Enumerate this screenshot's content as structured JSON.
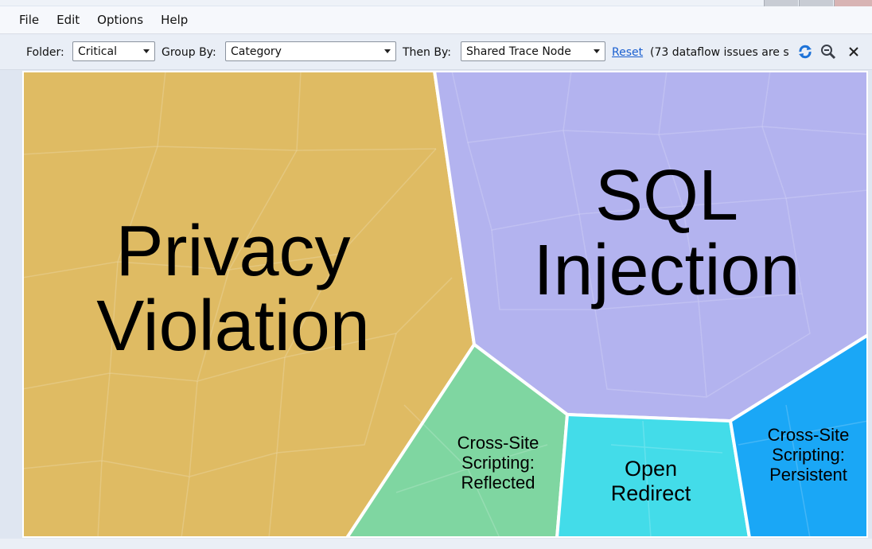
{
  "menu": [
    "File",
    "Edit",
    "Options",
    "Help"
  ],
  "toolbar": {
    "folder_label": "Folder:",
    "folder_value": "Critical",
    "group_by_label": "Group By:",
    "group_by_value": "Category",
    "then_by_label": "Then By:",
    "then_by_value": "Shared Trace Node",
    "reset_label": "Reset",
    "status_text": "(73 dataflow issues are s",
    "icons": [
      "refresh-icon",
      "zoom-out-icon",
      "close-icon"
    ]
  },
  "treemap": {
    "cells": [
      {
        "name": "Privacy Violation",
        "color": "#dfbb63"
      },
      {
        "name": "SQL Injection",
        "color": "#b3b3ef"
      },
      {
        "name": "Cross-Site Scripting: Reflected",
        "color": "#7fd6a1"
      },
      {
        "name": "Open Redirect",
        "color": "#43dce9"
      },
      {
        "name": "Cross-Site Scripting: Persistent",
        "color": "#1aa7f6"
      }
    ],
    "labels": {
      "privacy_1": "Privacy",
      "privacy_2": "Violation",
      "sql_1": "SQL",
      "sql_2": "Injection",
      "xss_r_1": "Cross-Site",
      "xss_r_2": "Scripting:",
      "xss_r_3": "Reflected",
      "redirect_1": "Open",
      "redirect_2": "Redirect",
      "xss_p_1": "Cross-Site",
      "xss_p_2": "Scripting:",
      "xss_p_3": "Persistent"
    }
  }
}
